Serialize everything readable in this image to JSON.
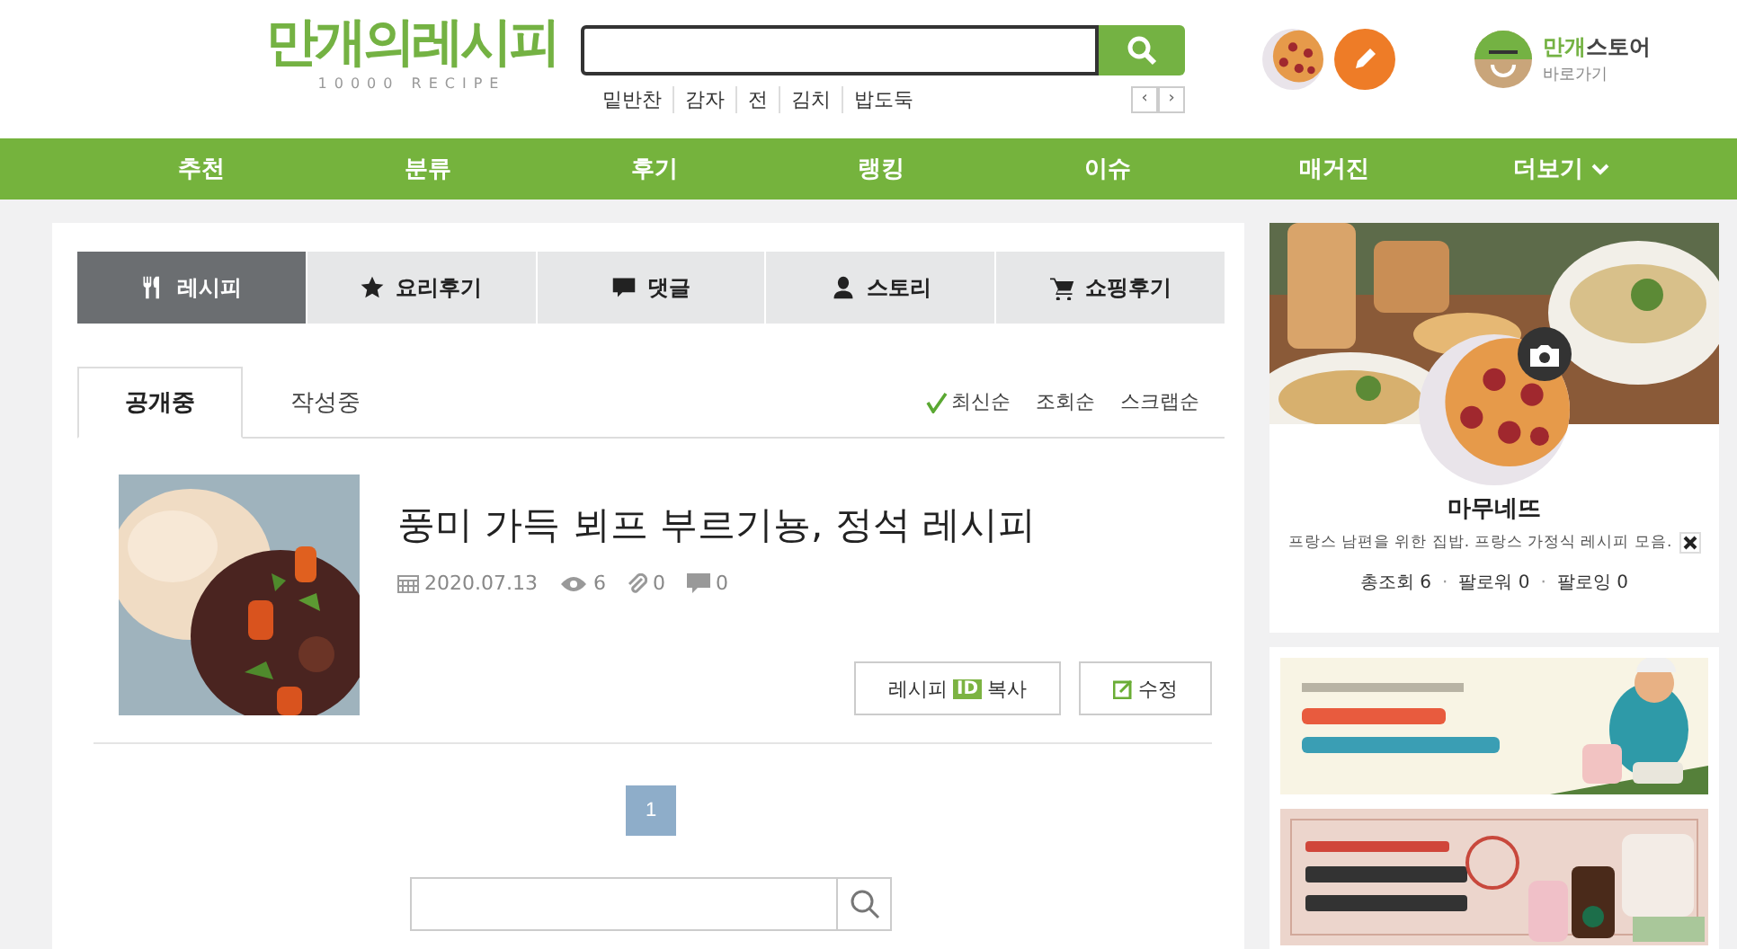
{
  "header": {
    "logo": {
      "title": "만개의레시피",
      "subtitle": "10000 RECIPE"
    },
    "keywords": [
      "밑반찬",
      "감자",
      "전",
      "김치",
      "밥도둑"
    ],
    "pager": [
      "‹",
      "›"
    ],
    "store": {
      "brand": "만개",
      "name": "스토어",
      "sub": "바로가기"
    }
  },
  "nav": [
    {
      "label": "추천"
    },
    {
      "label": "분류"
    },
    {
      "label": "후기"
    },
    {
      "label": "랭킹"
    },
    {
      "label": "이슈"
    },
    {
      "label": "매거진"
    },
    {
      "label": "더보기",
      "dropdown": true
    }
  ],
  "tabs": [
    {
      "label": "레시피",
      "kind": "utensils",
      "selected": true
    },
    {
      "label": "요리후기",
      "kind": "star",
      "selected": false
    },
    {
      "label": "댓글",
      "kind": "comment",
      "selected": false
    },
    {
      "label": "스토리",
      "kind": "user",
      "selected": false
    },
    {
      "label": "쇼핑후기",
      "kind": "cart",
      "selected": false
    }
  ],
  "subtabs": [
    {
      "label": "공개중",
      "selected": true
    },
    {
      "label": "작성중",
      "selected": false
    }
  ],
  "sort": [
    {
      "label": "최신순",
      "selected": true
    },
    {
      "label": "조회순",
      "selected": false
    },
    {
      "label": "스크랩순",
      "selected": false
    }
  ],
  "recipes": [
    {
      "title": "풍미 가득 뵈프 부르기뇽, 정석 레시피",
      "date": "2020.07.13",
      "views": "6",
      "attachments": "0",
      "comments": "0",
      "copy": {
        "before": "레시피",
        "badge": "ID",
        "after": "복사"
      },
      "edit": "수정"
    }
  ],
  "pagination": [
    {
      "label": "1",
      "selected": true
    }
  ],
  "profile": {
    "name": "마무네뜨",
    "bio": "프랑스 남편을 위한 집밥. 프랑스 가정식 레시피 모음.",
    "stats": [
      "총조회 6",
      "팔로워 0",
      "팔로잉 0"
    ],
    "separators": [
      "·",
      "·"
    ]
  }
}
